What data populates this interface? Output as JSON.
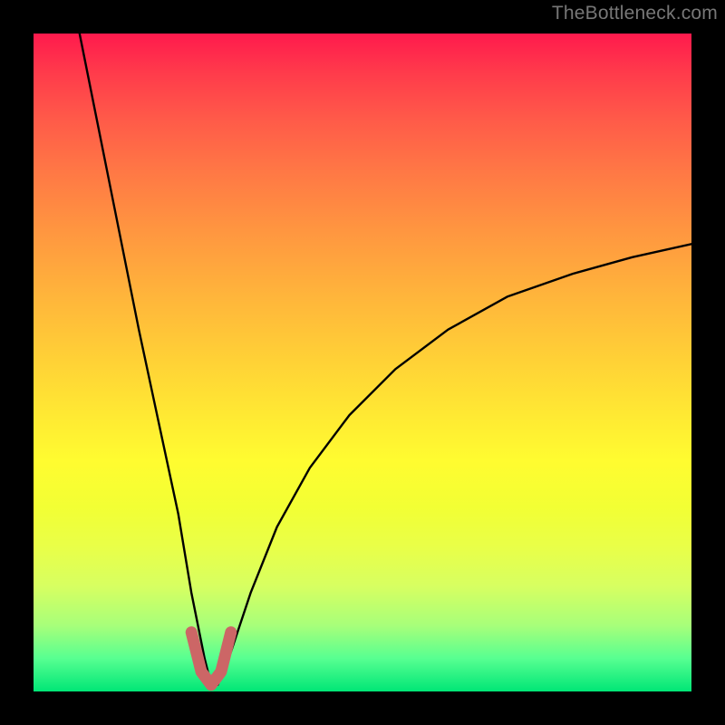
{
  "watermark": "TheBottleneck.com",
  "colors": {
    "background": "#000000",
    "gradient_top": "#ff1a4d",
    "gradient_bottom": "#00e676",
    "curve_stroke": "#000000",
    "highlight_stroke": "#cc6666"
  },
  "chart_data": {
    "type": "line",
    "title": "",
    "xlabel": "",
    "ylabel": "",
    "xlim": [
      0,
      100
    ],
    "ylim": [
      0,
      100
    ],
    "grid": false,
    "legend": false,
    "description": "V-shaped bottleneck curve. Minimum (≈0) near x≈27. Left branch rises steeply to y≈100 at x≈7; right branch rises to y≈68 at x=100.",
    "series": [
      {
        "name": "bottleneck-curve",
        "x": [
          7,
          10,
          13,
          16,
          19,
          22,
          24,
          26,
          27,
          28,
          30,
          33,
          37,
          42,
          48,
          55,
          63,
          72,
          82,
          91,
          100
        ],
        "y": [
          100,
          85,
          70,
          55,
          41,
          27,
          15,
          5,
          1,
          1,
          6,
          15,
          25,
          34,
          42,
          49,
          55,
          60,
          63.5,
          66,
          68
        ]
      }
    ],
    "highlight": {
      "description": "Pink thick segment at the valley floor",
      "x": [
        24,
        25.5,
        27,
        28.5,
        30
      ],
      "y": [
        9,
        3,
        1,
        3,
        9
      ]
    }
  }
}
